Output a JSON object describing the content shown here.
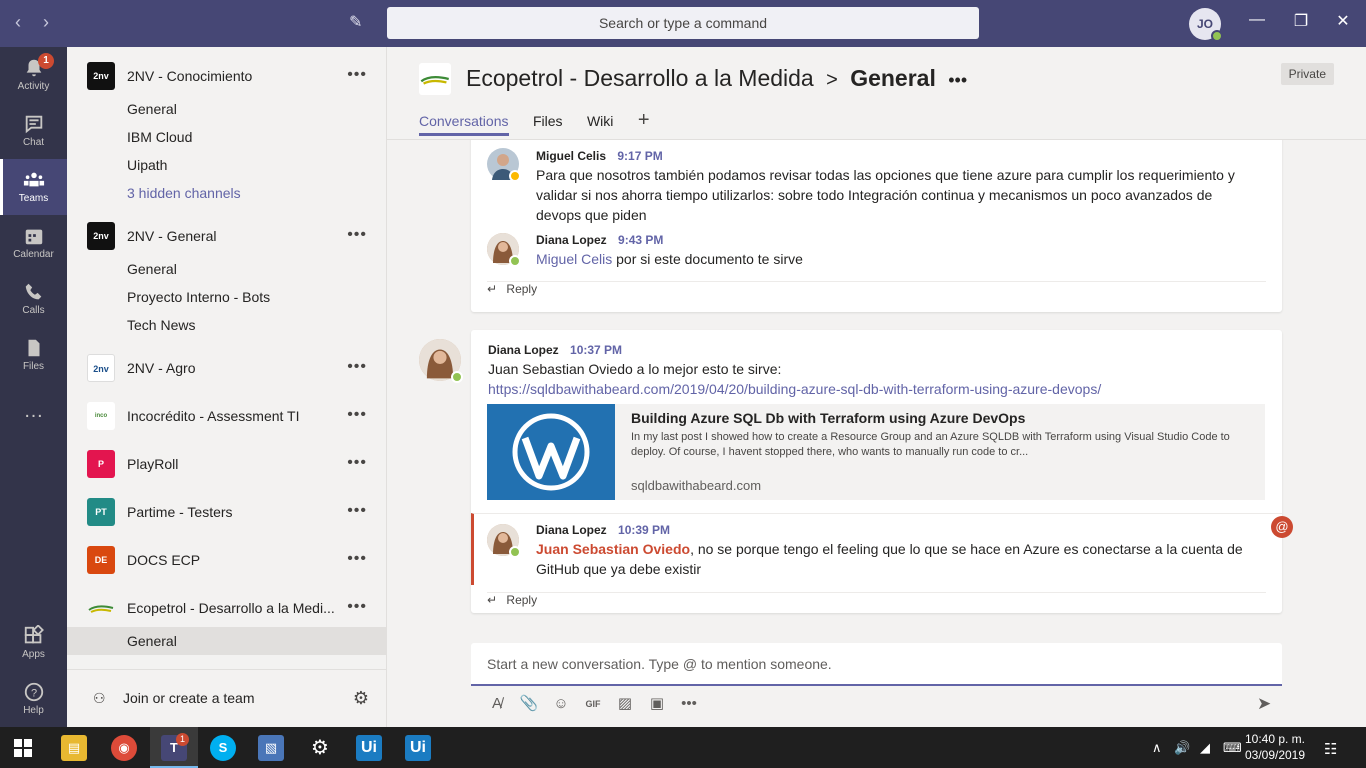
{
  "titlebar": {
    "search_placeholder": "Search or type a command",
    "user_initials": "JO",
    "status_color": "#92c353"
  },
  "rail": {
    "items": [
      {
        "label": "Activity",
        "icon": "bell-icon",
        "badge": "1"
      },
      {
        "label": "Chat",
        "icon": "chat-icon"
      },
      {
        "label": "Teams",
        "icon": "teams-icon"
      },
      {
        "label": "Calendar",
        "icon": "calendar-icon"
      },
      {
        "label": "Calls",
        "icon": "phone-icon"
      },
      {
        "label": "Files",
        "icon": "file-icon"
      },
      {
        "label": "Apps",
        "icon": "apps-icon"
      },
      {
        "label": "Help",
        "icon": "help-icon"
      }
    ]
  },
  "teams": {
    "list": [
      {
        "name": "2NV - Conocimiento",
        "logo": "2nv",
        "channels": [
          "General",
          "IBM Cloud",
          "Uipath"
        ],
        "hidden": "3 hidden channels"
      },
      {
        "name": "2NV - General",
        "logo": "2nv",
        "channels": [
          "General",
          "Proyecto Interno - Bots",
          "Tech News"
        ]
      },
      {
        "name": "2NV - Agro",
        "logo": "2nv"
      },
      {
        "name": "Incocrédito - Assessment TI",
        "logo": "incocredito"
      },
      {
        "name": "PlayRoll",
        "logo": "P"
      },
      {
        "name": "Partime - Testers",
        "logo": "PT"
      },
      {
        "name": "DOCS ECP",
        "logo": "DE"
      },
      {
        "name": "Ecopetrol - Desarrollo a la Medi...",
        "logo": "ecopetrol",
        "channels": [
          "General"
        ]
      }
    ],
    "join_label": "Join or create a team"
  },
  "header": {
    "team": "Ecopetrol - Desarrollo a la Medida",
    "separator": ">",
    "channel": "General",
    "privacy": "Private",
    "tabs": [
      "Conversations",
      "Files",
      "Wiki"
    ]
  },
  "conversation": {
    "thread1": {
      "msg1": {
        "author": "Miguel Celis",
        "time": "9:17 PM",
        "text": "Para que nosotros también podamos revisar todas las opciones que tiene azure para cumplir los requerimiento y validar si nos ahorra tiempo utilizarlos: sobre todo Integración continua y mecanismos un poco avanzados de devops que piden"
      },
      "msg2": {
        "author": "Diana Lopez",
        "time": "9:43 PM",
        "mention": "Miguel Celis",
        "text": " por si este documento te sirve"
      },
      "reply": "Reply"
    },
    "thread2": {
      "msg1": {
        "author": "Diana Lopez",
        "time": "10:37 PM",
        "text": "Juan Sebastian Oviedo a lo mejor esto te sirve:",
        "link": "https://sqldbawithabeard.com/2019/04/20/building-azure-sql-db-with-terraform-using-azure-devops/"
      },
      "preview": {
        "title": "Building Azure SQL Db with Terraform using Azure DevOps",
        "description": "In my last post I showed how to create a Resource Group and an Azure SQLDB with Terraform using Visual Studio Code to deploy. Of course, I havent stopped there, who wants to manually run code to cr...",
        "host": "sqldbawithabeard.com"
      },
      "msg2": {
        "author": "Diana Lopez",
        "time": "10:39 PM",
        "mention": "Juan Sebastian Oviedo",
        "text": ", no se porque tengo el feeling que lo que se hace en Azure es conectarse a la cuenta de GitHub que ya debe existir"
      },
      "reply": "Reply"
    }
  },
  "compose": {
    "placeholder": "Start a new conversation. Type @ to mention someone."
  },
  "taskbar": {
    "time": "10:40 p. m.",
    "date": "03/09/2019",
    "teams_badge": "1"
  }
}
